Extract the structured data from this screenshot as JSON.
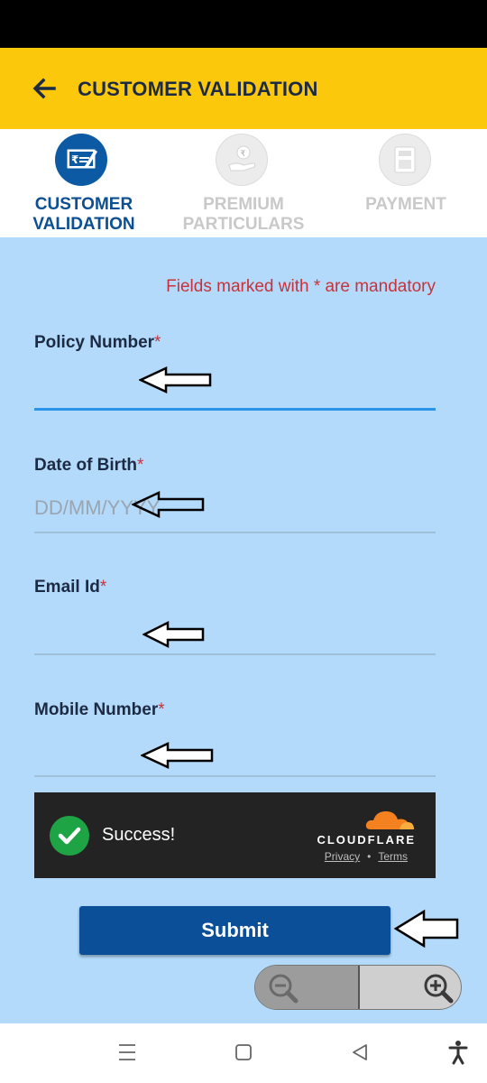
{
  "header": {
    "title": "CUSTOMER VALIDATION"
  },
  "steps": [
    {
      "line1": "CUSTOMER",
      "line2": "VALIDATION",
      "active": true
    },
    {
      "line1": "PREMIUM",
      "line2": "PARTICULARS",
      "active": false
    },
    {
      "line1": "PAYMENT",
      "line2": "",
      "active": false
    }
  ],
  "form": {
    "mandatory_note": "Fields marked with * are mandatory",
    "star": "*",
    "policy_number": {
      "label": "Policy Number",
      "value": "",
      "placeholder": ""
    },
    "dob": {
      "label": "Date of Birth",
      "value": "",
      "placeholder": "DD/MM/YYYY"
    },
    "email": {
      "label": "Email Id",
      "value": "",
      "placeholder": ""
    },
    "mobile": {
      "label": "Mobile Number",
      "value": "",
      "placeholder": ""
    }
  },
  "captcha": {
    "status": "Success!",
    "brand": "CLOUDFLARE",
    "privacy": "Privacy",
    "separator": "•",
    "terms": "Terms"
  },
  "submit_label": "Submit",
  "colors": {
    "header_bg": "#fcc80b",
    "form_bg": "#b3dafa",
    "primary": "#0a4f97",
    "mandatory": "#c8323b",
    "success": "#1ea445",
    "cloudflare_orange": "#f48120"
  },
  "icons": {
    "back": "arrow-left-icon",
    "step1": "cheque-icon",
    "step2": "rupee-hand-icon",
    "step3": "payment-machine-icon",
    "captcha": "check-icon",
    "zoom_out": "zoom-out-icon",
    "zoom_in": "zoom-in-icon",
    "nav_menu": "menu-icon",
    "nav_home": "home-icon",
    "nav_back": "back-triangle-icon",
    "nav_accessibility": "accessibility-icon"
  }
}
